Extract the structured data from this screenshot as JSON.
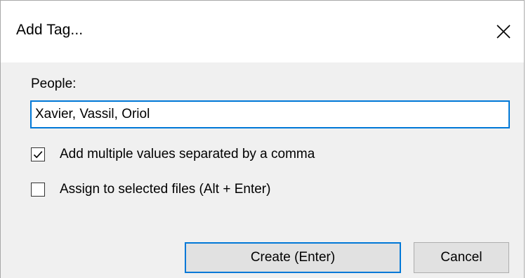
{
  "window": {
    "title": "Add Tag...",
    "close_icon": "close-icon"
  },
  "form": {
    "field_label": "People:",
    "field_value": "Xavier, Vassil, Oriol",
    "options": [
      {
        "label": "Add multiple values separated by a comma",
        "checked": true
      },
      {
        "label": "Assign to selected files (Alt + Enter)",
        "checked": false
      }
    ]
  },
  "buttons": {
    "create_label": "Create (Enter)",
    "cancel_label": "Cancel"
  },
  "colors": {
    "accent": "#0078d7",
    "dialog_background": "#f0f0f0",
    "titlebar_background": "#ffffff",
    "button_background": "#e1e1e1"
  }
}
